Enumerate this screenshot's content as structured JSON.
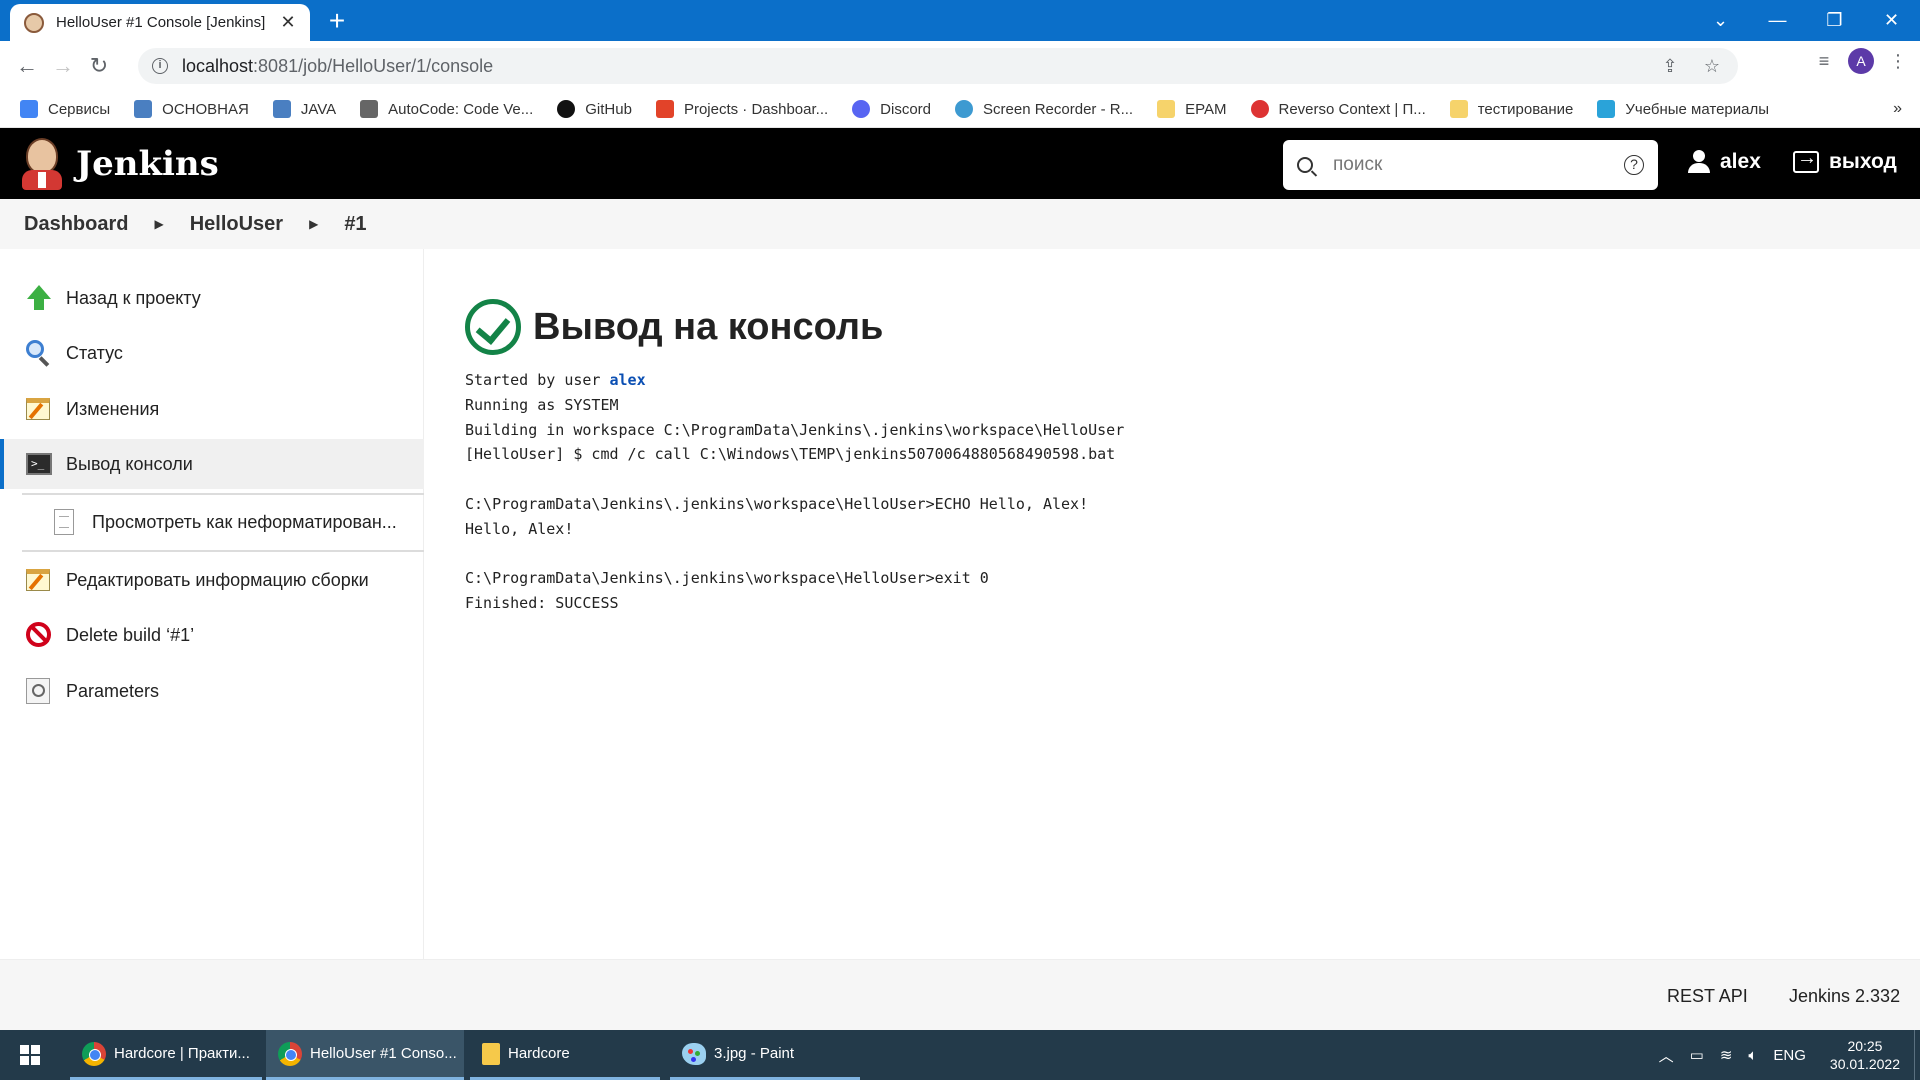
{
  "browser": {
    "tab_title": "HelloUser #1 Console [Jenkins]",
    "new_tab": "+",
    "url_host": "localhost",
    "url_rest": ":8081/job/HelloUser/1/console",
    "profile_initial": "A",
    "win": {
      "chevron": "⌄",
      "minimize": "—",
      "restore": "❐",
      "close": "✕"
    }
  },
  "bookmarks": [
    {
      "label": "Сервисы",
      "icon": "apps-grid-icon",
      "color": "#4285f4"
    },
    {
      "label": "ОСНОВНАЯ",
      "icon": "book-icon",
      "color": "#4a7fc1"
    },
    {
      "label": "JAVA",
      "icon": "book-icon",
      "color": "#4a7fc1"
    },
    {
      "label": "AutoCode: Code Ve...",
      "icon": "autocode-icon",
      "color": "#666666"
    },
    {
      "label": "GitHub",
      "icon": "github-icon",
      "color": "#111111"
    },
    {
      "label": "Projects · Dashboar...",
      "icon": "gitlab-icon",
      "color": "#e24329"
    },
    {
      "label": "Discord",
      "icon": "discord-icon",
      "color": "#5865f2"
    },
    {
      "label": "Screen Recorder - R...",
      "icon": "recorder-icon",
      "color": "#3d9ad1"
    },
    {
      "label": "EPAM",
      "icon": "folder-icon",
      "color": "#f6d36b"
    },
    {
      "label": "Reverso Context | П...",
      "icon": "reverso-icon",
      "color": "#d33"
    },
    {
      "label": "тестирование",
      "icon": "folder-icon",
      "color": "#f6d36b"
    },
    {
      "label": "Учебные материалы",
      "icon": "edu-icon",
      "color": "#2aa3d9"
    }
  ],
  "bookmarks_more": "»",
  "jenkins": {
    "logo_text": "Jenkins",
    "search_placeholder": "поиск",
    "help": "?",
    "user": "alex",
    "logout": "выход"
  },
  "breadcrumb": [
    "Dashboard",
    "HelloUser",
    "#1"
  ],
  "tasks": {
    "back": "Назад к проекту",
    "status": "Статус",
    "changes": "Изменения",
    "console": "Вывод консоли",
    "plain": "Просмотреть как неформатирован...",
    "edit": "Редактировать информацию сборки",
    "delete": "Delete build ‘#1’",
    "params": "Parameters"
  },
  "main": {
    "title": "Вывод на консоль",
    "console": {
      "started_prefix": "Started by user ",
      "started_user": "alex",
      "rest": "Running as SYSTEM\nBuilding in workspace C:\\ProgramData\\Jenkins\\.jenkins\\workspace\\HelloUser\n[HelloUser] $ cmd /c call C:\\Windows\\TEMP\\jenkins5070064880568490598.bat\n\nC:\\ProgramData\\Jenkins\\.jenkins\\workspace\\HelloUser>ECHO Hello, Alex!\nHello, Alex!\n\nC:\\ProgramData\\Jenkins\\.jenkins\\workspace\\HelloUser>exit 0\nFinished: SUCCESS"
    }
  },
  "footer": {
    "rest_api": "REST API",
    "version": "Jenkins 2.332"
  },
  "taskbar": {
    "apps": [
      {
        "label": "Hardcore | Практи...",
        "icon": "chrome-icon"
      },
      {
        "label": "HelloUser #1 Conso...",
        "icon": "chrome-icon"
      },
      {
        "label": "Hardcore",
        "icon": "folder-icon"
      },
      {
        "label": "3.jpg - Paint",
        "icon": "paint-icon"
      }
    ],
    "lang": "ENG",
    "time": "20:25",
    "date": "30.01.2022"
  }
}
